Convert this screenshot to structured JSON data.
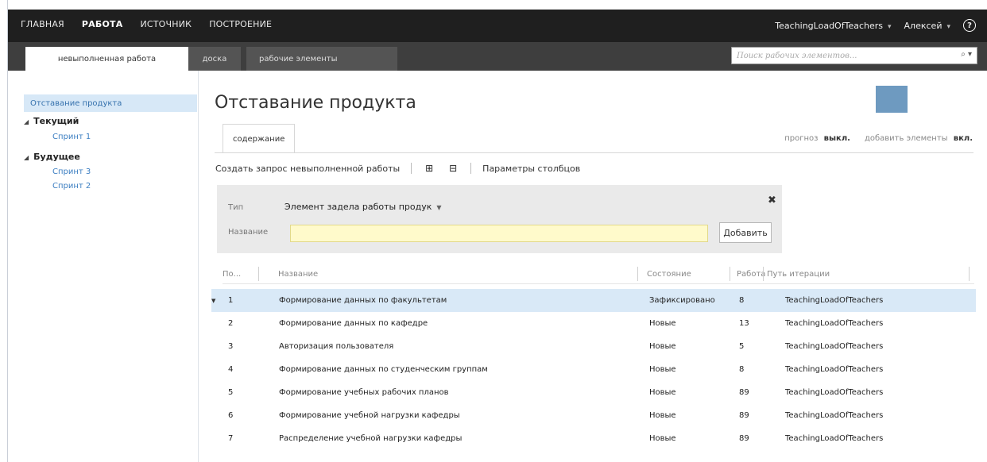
{
  "topnav": {
    "items": [
      "ГЛАВНАЯ",
      "РАБОТА",
      "ИСТОЧНИК",
      "ПОСТРОЕНИЕ"
    ],
    "project": "TeachingLoadOfTeachers",
    "user": "Алексей",
    "caret": "▾"
  },
  "tabs": {
    "items": [
      "невыполненная работа",
      "доска",
      "рабочие элементы"
    ],
    "search_placeholder": "Поиск рабочих элементов..."
  },
  "sidebar": {
    "backlog": "Отставание продукта",
    "current": "Текущий",
    "current_children": [
      "Спринт 1"
    ],
    "future": "Будущее",
    "future_children": [
      "Спринт 3",
      "Спринт 2"
    ]
  },
  "main": {
    "title": "Отставание продукта",
    "subtab": "содержание",
    "forecast_label": "прогноз",
    "forecast_value": "выкл.",
    "add_items_label": "добавить элементы",
    "add_items_value": "вкл.",
    "toolbar": {
      "create_query": "Создать запрос невыполненной работы",
      "column_options": "Параметры столбцов"
    }
  },
  "add_panel": {
    "type_label": "Тип",
    "type_value": "Элемент задела работы продук",
    "title_label": "Название",
    "title_value": "",
    "add_button": "Добавить"
  },
  "grid": {
    "columns": [
      "По...",
      "Название",
      "Состояние",
      "Работа",
      "Путь итерации"
    ],
    "rows": [
      {
        "order": "1",
        "title": "Формирование данных по факультетам",
        "state": "Зафиксировано",
        "work": "8",
        "path": "TeachingLoadOfTeachers"
      },
      {
        "order": "2",
        "title": "Формирование данных по кафедре",
        "state": "Новые",
        "work": "13",
        "path": "TeachingLoadOfTeachers"
      },
      {
        "order": "3",
        "title": "Авторизация пользователя",
        "state": "Новые",
        "work": "5",
        "path": "TeachingLoadOfTeachers"
      },
      {
        "order": "4",
        "title": "Формирование данных по студенческим группам",
        "state": "Новые",
        "work": "8",
        "path": "TeachingLoadOfTeachers"
      },
      {
        "order": "5",
        "title": "Формирование учебных рабочих планов",
        "state": "Новые",
        "work": "89",
        "path": "TeachingLoadOfTeachers"
      },
      {
        "order": "6",
        "title": "Формирование учебной нагрузки кафедры",
        "state": "Новые",
        "work": "89",
        "path": "TeachingLoadOfTeachers"
      },
      {
        "order": "7",
        "title": "Распределение учебной нагрузки кафедры",
        "state": "Новые",
        "work": "89",
        "path": "TeachingLoadOfTeachers"
      }
    ]
  },
  "colors": {
    "topbar": "#1f1f1f",
    "tabbar": "#3e3e3e",
    "selection": "#d9e9f7",
    "link": "#3d7fc2",
    "input_highlight": "#fffacb"
  }
}
